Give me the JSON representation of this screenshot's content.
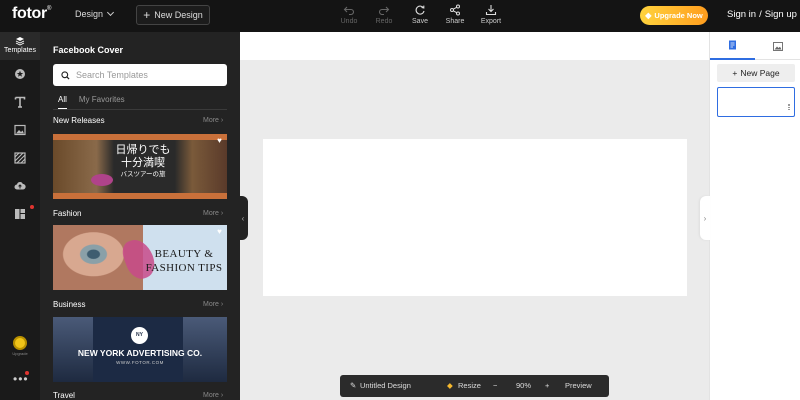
{
  "topbar": {
    "logo": "fotor",
    "logo_mark": "®",
    "design_menu_label": "Design",
    "new_design_label": "New Design",
    "tools": [
      {
        "label": "Undo",
        "icon": "undo-icon",
        "enabled": false
      },
      {
        "label": "Redo",
        "icon": "redo-icon",
        "enabled": false
      },
      {
        "label": "Save",
        "icon": "save-icon",
        "enabled": true
      },
      {
        "label": "Share",
        "icon": "share-icon",
        "enabled": true
      },
      {
        "label": "Export",
        "icon": "export-icon",
        "enabled": true
      }
    ],
    "upgrade_label": "Upgrade Now",
    "sign_in_label": "Sign in",
    "auth_separator": "/",
    "sign_up_label": "Sign up"
  },
  "rail": {
    "items": [
      {
        "name": "templates",
        "label": "Templates",
        "icon": "layers-icon",
        "active": true
      },
      {
        "name": "elements",
        "icon": "elements-icon"
      },
      {
        "name": "text",
        "icon": "text-icon"
      },
      {
        "name": "photos",
        "icon": "image-icon"
      },
      {
        "name": "background",
        "icon": "background-icon"
      },
      {
        "name": "uploads",
        "icon": "cloud-upload-icon"
      },
      {
        "name": "apps",
        "icon": "apps-icon",
        "badge": true
      }
    ],
    "avatar_label": "Upgrade",
    "more_icon": "more-icon"
  },
  "panel": {
    "title": "Facebook Cover",
    "search_placeholder": "Search Templates",
    "tabs": [
      {
        "label": "All",
        "active": true
      },
      {
        "label": "My Favorites",
        "active": false
      }
    ],
    "more_label": "More",
    "sections": [
      {
        "label": "New Releases",
        "thumb_text": "日帰りでも\n十分満喫",
        "thumb_sub": "バスツアーの旅"
      },
      {
        "label": "Fashion",
        "thumb_text_1": "BEAUTY &",
        "thumb_text_2": "FASHION TIPS"
      },
      {
        "label": "Business",
        "thumb_badge": "NY",
        "thumb_text": "NEW YORK ADVERTISING CO.",
        "thumb_sub": "WWW.FOTOR.COM"
      },
      {
        "label": "Travel"
      }
    ]
  },
  "bottom_bar": {
    "title": "Untitled Design",
    "resize_label": "Resize",
    "zoom_out": "−",
    "zoom": "90%",
    "zoom_in": "+",
    "preview_label": "Preview"
  },
  "right_panel": {
    "new_page_label": "New Page",
    "tabs": [
      {
        "icon": "pages-icon",
        "active": true
      },
      {
        "icon": "image-icon",
        "active": false
      }
    ]
  },
  "colors": {
    "accent": "#2f6de1",
    "upgrade_gradient_start": "#ffd33d",
    "upgrade_gradient_end": "#ff9d1e",
    "dark_bg": "#141414",
    "canvas_bg": "#ebebeb"
  }
}
